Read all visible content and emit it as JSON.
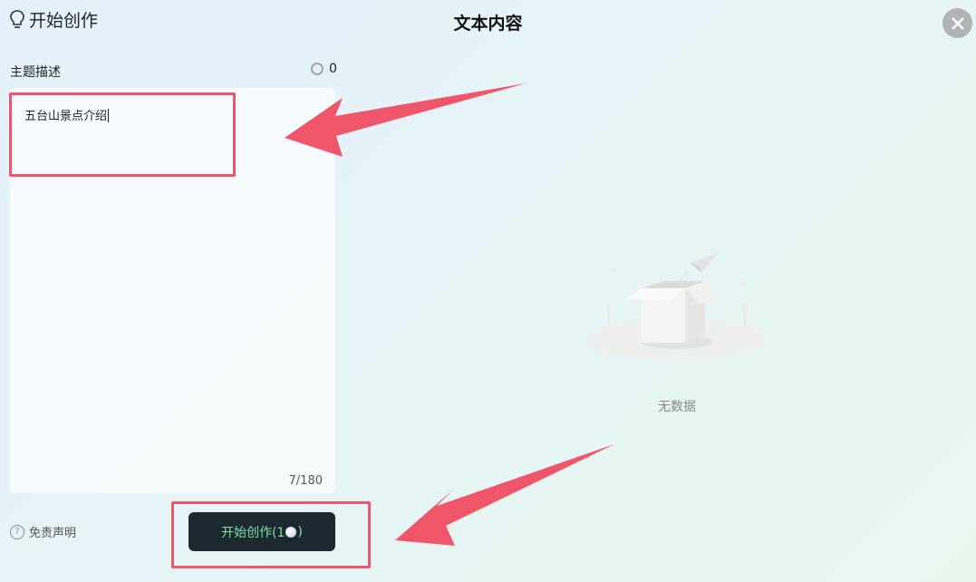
{
  "header": {
    "start_label": "开始创作",
    "panel_title": "文本内容"
  },
  "input_section": {
    "label": "主题描述",
    "counter_value": "0",
    "text_value": "五台山景点介绍",
    "char_count": "7/180"
  },
  "footer": {
    "disclaimer_label": "免责声明",
    "start_button_prefix": "开始创作(1",
    "start_button_suffix": ")"
  },
  "result": {
    "empty_text": "无数据"
  },
  "icons": {
    "header": "lightbulb-icon",
    "close": "close-icon",
    "counter": "coin-icon",
    "disclaimer": "help-icon",
    "empty": "empty-box-icon"
  },
  "colors": {
    "highlight": "#f0566a",
    "button_bg": "#1d2830",
    "button_text": "#7ee3a0"
  }
}
